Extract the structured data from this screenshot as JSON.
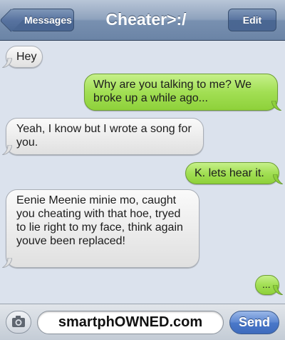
{
  "header": {
    "back_label": "Messages",
    "title": "Cheater>:/",
    "edit_label": "Edit"
  },
  "messages": [
    {
      "direction": "incoming",
      "text": "Hey"
    },
    {
      "direction": "outgoing",
      "text": "Why are you talking to me? We broke up a while ago..."
    },
    {
      "direction": "incoming",
      "text": "Yeah, I know but I wrote a song for you."
    },
    {
      "direction": "outgoing",
      "text": "K. lets hear it."
    },
    {
      "direction": "incoming",
      "text": "Eenie Meenie minie mo, caught you cheating with that hoe, tryed to lie right to my face, think again youve been replaced!"
    },
    {
      "direction": "outgoing",
      "text": "..."
    }
  ],
  "composer": {
    "camera_icon": "camera-icon",
    "input_value": "smartphOWNED.com",
    "send_label": "Send"
  },
  "colors": {
    "incoming_bubble": "#e8e8e8",
    "outgoing_bubble": "#a2df54",
    "background": "#dbe2ed",
    "navbar": "#7890b0",
    "send_button": "#4a78c9"
  }
}
